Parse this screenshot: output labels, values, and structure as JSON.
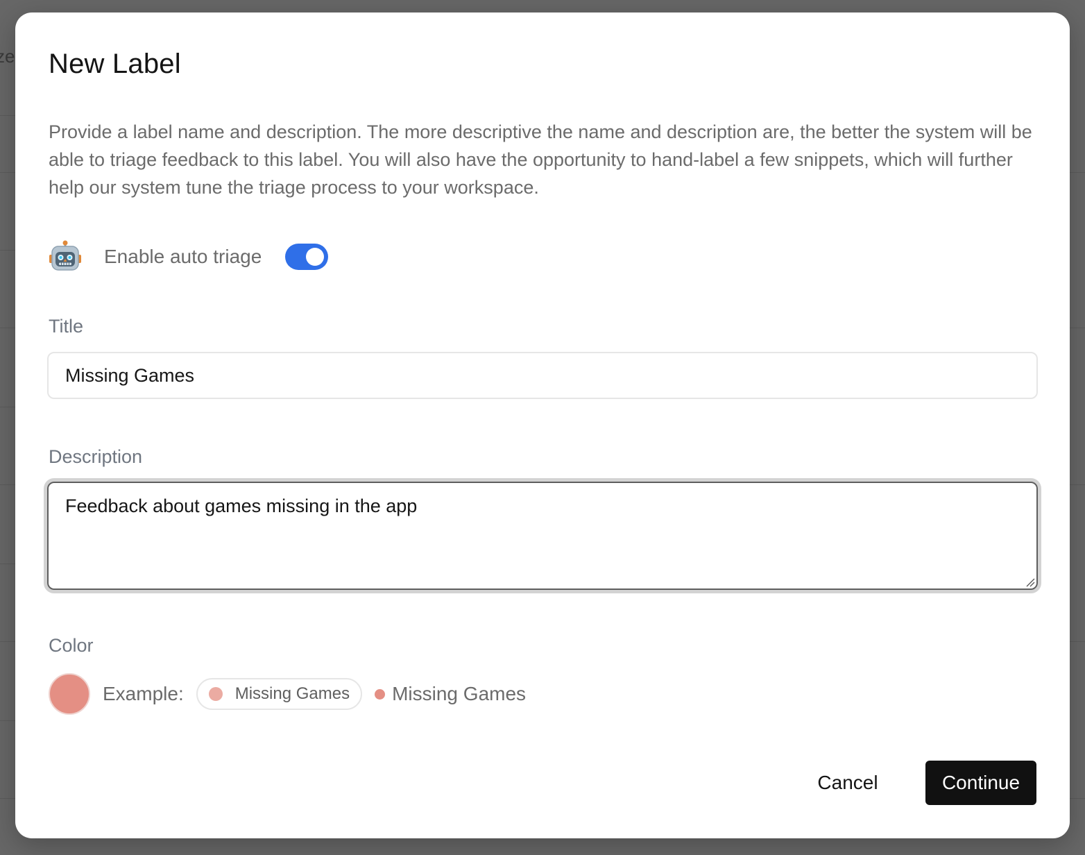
{
  "background": {
    "fragment_text": "ze"
  },
  "dialog": {
    "title": "New Label",
    "description": "Provide a label name and description. The more descriptive the name and description are, the better the system will be able to triage feedback to this label. You will also have the opportunity to hand-label a few snippets, which will further help our system tune the triage process to your workspace.",
    "auto_triage": {
      "icon": "robot-icon",
      "label": "Enable auto triage",
      "enabled": true,
      "toggle_color": "#2f6fe8"
    },
    "title_field": {
      "label": "Title",
      "value": "Missing Games"
    },
    "description_field": {
      "label": "Description",
      "value": "Feedback about games missing in the app"
    },
    "color_field": {
      "label": "Color",
      "selected_color": "#e48f84",
      "example_label": "Example:",
      "chip_text": "Missing Games",
      "inline_text": "Missing Games"
    },
    "buttons": {
      "cancel": "Cancel",
      "continue": "Continue"
    }
  }
}
